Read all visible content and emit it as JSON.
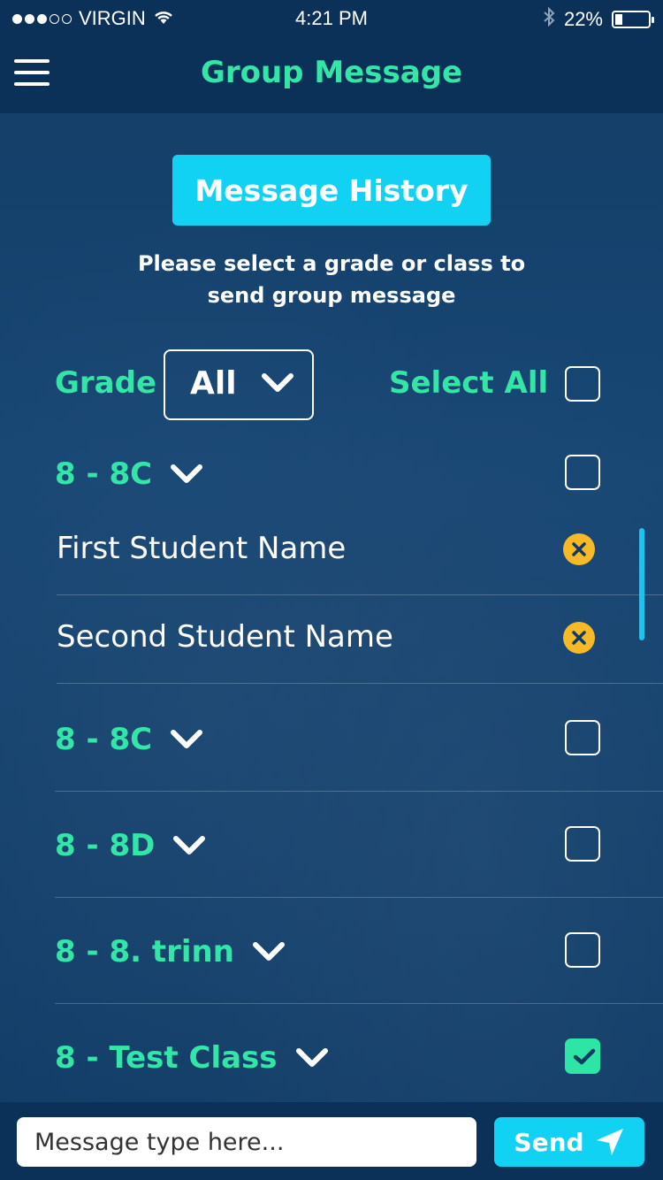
{
  "status_bar": {
    "carrier": "VIRGIN",
    "signal_dots_filled": 3,
    "signal_dots_total": 5,
    "time": "4:21 PM",
    "battery": "22%",
    "battery_level": 0.22
  },
  "nav": {
    "title": "Group Message",
    "menu_icon": "hamburger-menu-icon"
  },
  "main": {
    "history_button": "Message History",
    "instruction": "Please select a grade or class to send group message",
    "grade_label": "Grade",
    "grade_value": "All",
    "select_all_label": "Select All",
    "select_all_checked": false
  },
  "classes": [
    {
      "label": "8 - 8C",
      "checked": false,
      "expanded": true,
      "students": [
        "First Student Name",
        "Second Student Name"
      ]
    },
    {
      "label": "8 - 8C",
      "checked": false
    },
    {
      "label": "8 - 8D",
      "checked": false
    },
    {
      "label": "8 - 8. trinn",
      "checked": false
    },
    {
      "label": "8 - Test Class",
      "checked": true
    }
  ],
  "bottom": {
    "input_placeholder": "Message type here...",
    "send_label": "Send"
  },
  "colors": {
    "accent_green": "#33e6a7",
    "accent_cyan": "#12d2f4",
    "badge_orange": "#f6b928",
    "bar_bg": "#0c3158"
  }
}
